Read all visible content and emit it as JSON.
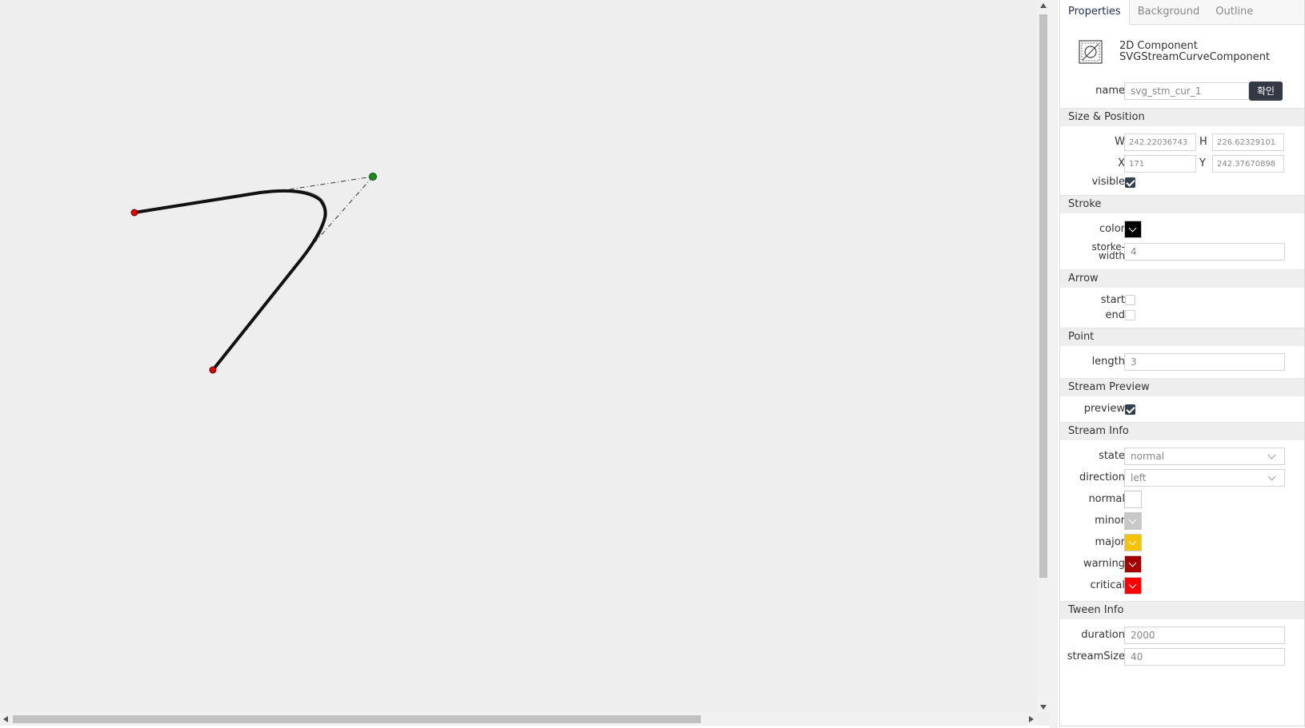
{
  "tabs": [
    "Properties",
    "Background",
    "Outline"
  ],
  "component": {
    "type": "2D Component",
    "class": "SVGStreamCurveComponent",
    "icon": "component-icon"
  },
  "name": {
    "label": "name",
    "value": "svg_stm_cur_1",
    "button": "확인"
  },
  "size_position": {
    "title": "Size & Position",
    "w_label": "W",
    "w_value": "242.22036743",
    "h_label": "H",
    "h_value": "226.62329101",
    "x_label": "X",
    "x_value": "171",
    "y_label": "Y",
    "y_value": "242.37670898",
    "visible_label": "visible",
    "visible": true
  },
  "stroke": {
    "title": "Stroke",
    "color_label": "color",
    "color": "#000000",
    "width_label": "storke-width",
    "width_value": "4"
  },
  "arrow": {
    "title": "Arrow",
    "start_label": "start",
    "start": false,
    "end_label": "end",
    "end": false
  },
  "point": {
    "title": "Point",
    "length_label": "length",
    "length_value": "3"
  },
  "stream_preview": {
    "title": "Stream Preview",
    "preview_label": "preview",
    "preview": true
  },
  "stream_info": {
    "title": "Stream Info",
    "state_label": "state",
    "state_value": "normal",
    "direction_label": "direction",
    "direction_value": "left",
    "colors": [
      {
        "label": "normal",
        "color": "#ffffff"
      },
      {
        "label": "minor",
        "color": "#c8c8c8"
      },
      {
        "label": "major",
        "color": "#f5c400"
      },
      {
        "label": "warning",
        "color": "#a50000"
      },
      {
        "label": "critical",
        "color": "#ff0000"
      }
    ]
  },
  "tween_info": {
    "title": "Tween Info",
    "duration_label": "duration",
    "duration_value": "2000",
    "stream_size_label": "streamSize",
    "stream_size_value": "40"
  },
  "canvas": {
    "curve_color": "#111111",
    "endpoint_color": "#e00000",
    "control_point_color": "#1a8a1a",
    "guide_color": "#333333"
  }
}
